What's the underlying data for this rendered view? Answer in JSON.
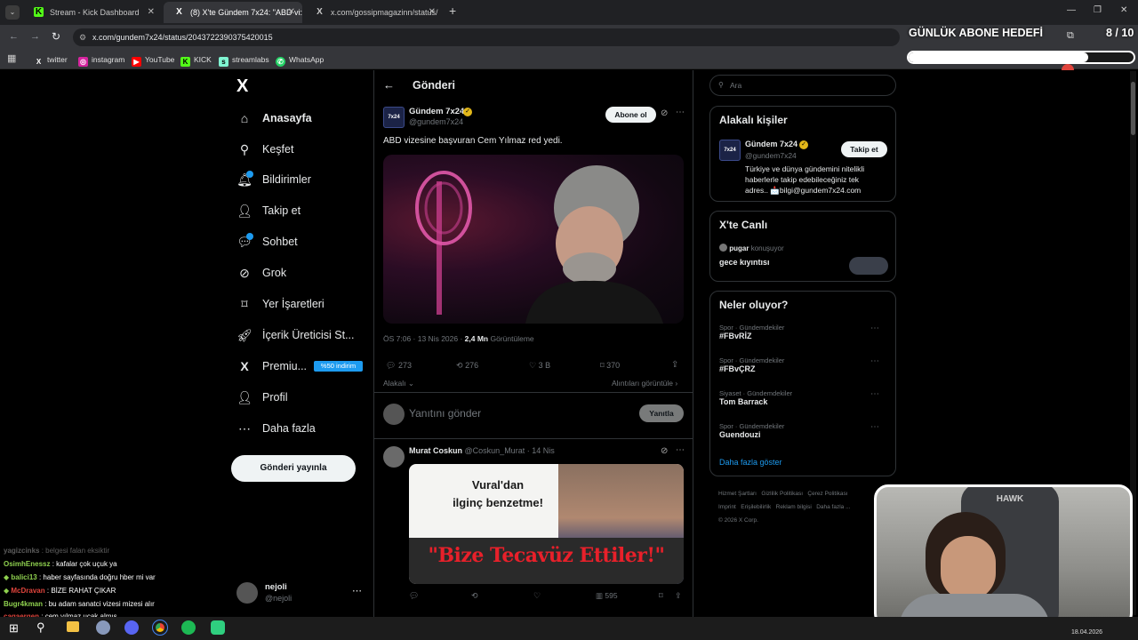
{
  "browser": {
    "tabs": [
      {
        "title": "Stream - Kick Dashboard",
        "icon": "K"
      },
      {
        "title": "(8) X'te Gündem 7x24: \"ABD vi:",
        "icon": "X"
      },
      {
        "title": "x.com/gossipmagazinn/status/",
        "icon": "X"
      }
    ],
    "url": "x.com/gundem7x24/status/2043722390375420015",
    "bookmarks": [
      "twitter",
      "instagram",
      "YouTube",
      "KICK",
      "streamlabs",
      "WhatsApp"
    ]
  },
  "overlay": {
    "goal_title": "GÜNLÜK ABONE HEDEFİ",
    "goal_count": "8 / 10",
    "goal_progress": 0.8
  },
  "sidebar": {
    "logo": "X",
    "items": [
      {
        "label": "Anasayfa",
        "icon": "home-icon"
      },
      {
        "label": "Keşfet",
        "icon": "search-icon"
      },
      {
        "label": "Bildirimler",
        "icon": "bell-icon"
      },
      {
        "label": "Takip et",
        "icon": "add-person-icon"
      },
      {
        "label": "Sohbet",
        "icon": "chat-icon"
      },
      {
        "label": "Grok",
        "icon": "grok-icon"
      },
      {
        "label": "Yer İşaretleri",
        "icon": "bookmark-icon"
      },
      {
        "label": "İçerik Üreticisi St...",
        "icon": "rocket-icon"
      },
      {
        "label": "Premiu...",
        "icon": "x-premium-icon"
      },
      {
        "label": "Profil",
        "icon": "person-icon"
      },
      {
        "label": "Daha fazla",
        "icon": "more-circle-icon"
      }
    ],
    "premium_badge": "%50 indirim",
    "post_button": "Gönderi yayınla",
    "account": {
      "name": "nejoli",
      "handle": "@nejoli"
    }
  },
  "post": {
    "header_title": "Gönderi",
    "author_name": "Gündem 7x24",
    "author_handle": "@gundem7x24",
    "follow_button": "Abone ol",
    "text": "ABD vizesine başvuran Cem Yılmaz red yedi.",
    "time": "ÖS 7:06 · 13 Nis 2026 ·",
    "views": "2,4 Mn",
    "views_label": "Görüntüleme",
    "replies": "273",
    "reposts": "276",
    "likes": "3 B",
    "bookmarks": "370",
    "relevance": "Alakalı",
    "quotes_link": "Alıntıları görüntüle",
    "reply_placeholder": "Yanıtını gönder",
    "reply_button": "Yanıtla"
  },
  "reply": {
    "author_name": "Murat Coskun",
    "author_handle": "@Coskun_Murat · 14 Nis",
    "image_top": "Vural'dan\nilginç benzetme!",
    "image_caption": "\"Bize Tecavüz Ettiler!\"",
    "views": "595"
  },
  "right": {
    "search_placeholder": "Ara",
    "related_title": "Alakalı kişiler",
    "related_name": "Gündem 7x24",
    "related_handle": "@gundem7x24",
    "related_follow": "Takip et",
    "related_bio": "Türkiye ve dünya gündemini nitelikli haberlerle takip edebileceğiniz tek adres.. 📩bilgi@gundem7x24.com",
    "live_title": "X'te Canlı",
    "live_user": "pugar",
    "live_status": "konuşuyor",
    "live_topic": "gece kıyıntısı",
    "trends_title": "Neler oluyor?",
    "trends": [
      {
        "category": "Spor · Gündemdekiler",
        "name": "#FBvRİZ"
      },
      {
        "category": "Spor · Gündemdekiler",
        "name": "#FBvÇRZ"
      },
      {
        "category": "Siyaset · Gündemdekiler",
        "name": "Tom Barrack"
      },
      {
        "category": "Spor · Gündemdekiler",
        "name": "Guendouzi"
      }
    ],
    "show_more": "Daha fazla göster",
    "footer": [
      "Hizmet Şartları",
      "Gizlilik Politikası",
      "Çerez Politikası",
      "Imprint",
      "Erişilebilirlik",
      "Reklam bilgisi",
      "Daha fazla ...",
      "© 2026 X Corp."
    ]
  },
  "chat": [
    {
      "user": "yagizcinks",
      "msg": "belgesi falan eksiktir",
      "color": "#5a5a5a"
    },
    {
      "user": "OsimhEnessz",
      "msg": "kafalar çok uçuk ya",
      "color": "#8fd14f"
    },
    {
      "user": "balici13",
      "msg": "haber sayfasında doğru hber mi var",
      "color": "#8fd14f"
    },
    {
      "user": "McDravan",
      "msg": "BİZE RAHAT ÇIKAR",
      "color": "#e0443c"
    },
    {
      "user": "Bugr4kman",
      "msg": "bu adam sanatci vizesi mizesi alır",
      "color": "#8fd14f"
    },
    {
      "user": "cagaergen",
      "msg": "cem yılmaz uçak almış",
      "color": "#e0443c"
    }
  ],
  "taskbar": {
    "date": "18.04.2026"
  },
  "webcam": {
    "logo_text": "HAWK"
  }
}
